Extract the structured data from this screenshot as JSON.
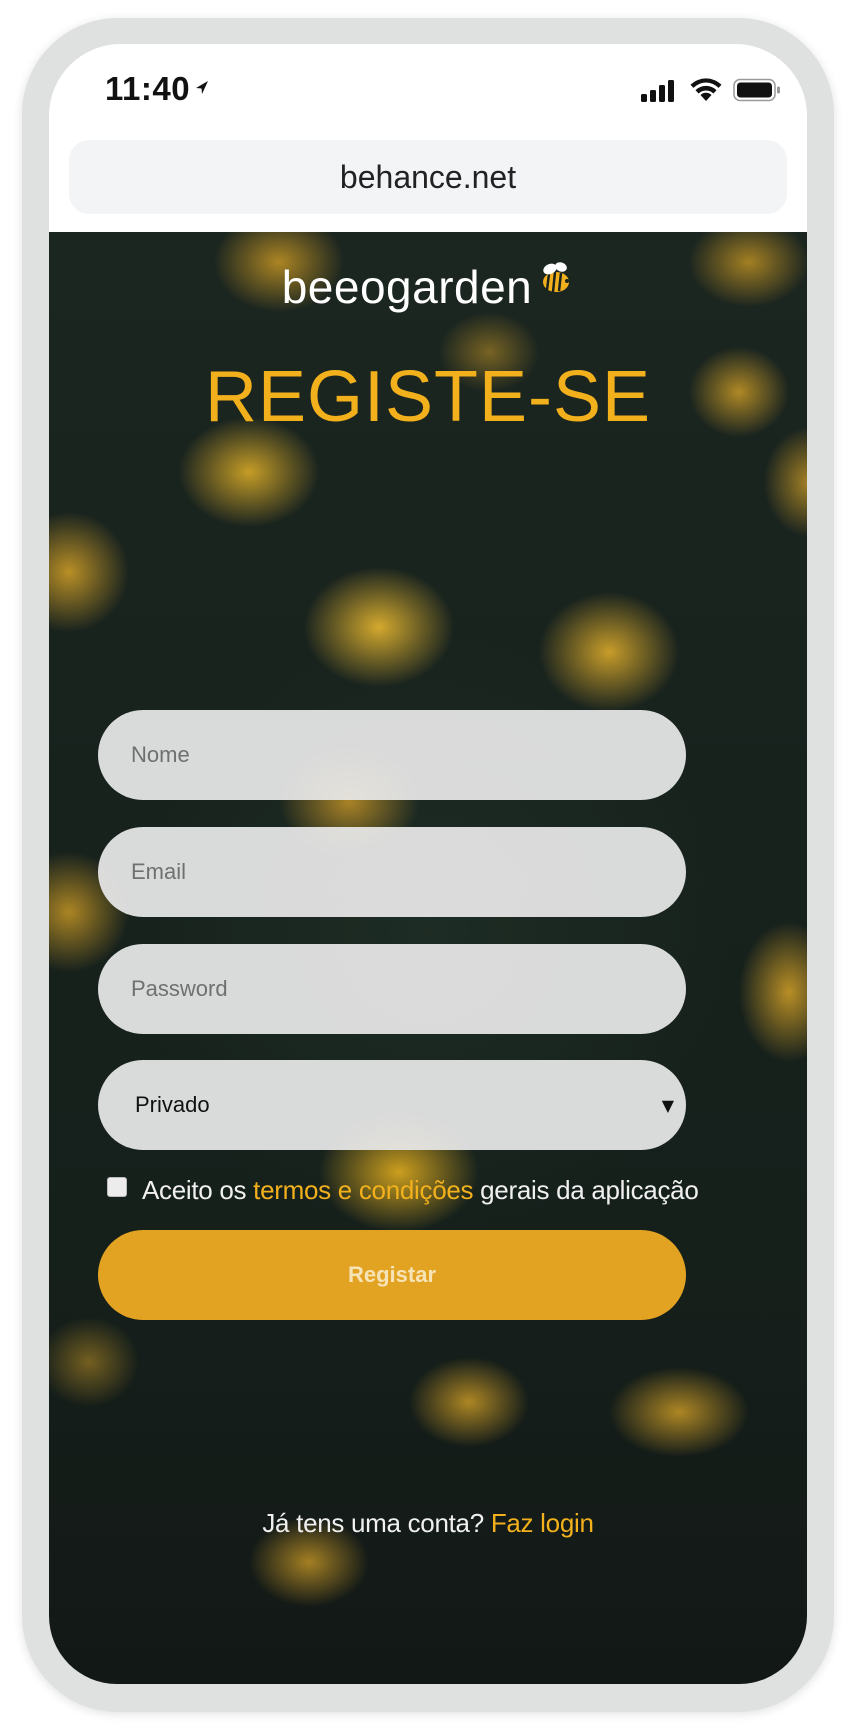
{
  "status_bar": {
    "time": "11:40"
  },
  "browser": {
    "url": "behance.net"
  },
  "app": {
    "logo_text": "beeogarden",
    "title": "REGISTE-SE"
  },
  "form": {
    "name_placeholder": "Nome",
    "email_placeholder": "Email",
    "password_placeholder": "Password",
    "account_type_value": "Privado",
    "terms_prefix": "Aceito os ",
    "terms_link": "termos e condições",
    "terms_suffix": " gerais da aplicação",
    "terms_checked": false,
    "submit_label": "Registar"
  },
  "footer": {
    "login_prompt": "Já tens uma conta? ",
    "login_link": "Faz login"
  },
  "colors": {
    "accent": "#f2b11c",
    "button": "#e3a322",
    "background": "#1a231e"
  },
  "icons": {
    "location": "location-arrow-icon",
    "signal": "cellular-signal-icon",
    "wifi": "wifi-icon",
    "battery": "battery-icon",
    "bee": "bee-icon",
    "dropdown": "chevron-down-icon"
  }
}
